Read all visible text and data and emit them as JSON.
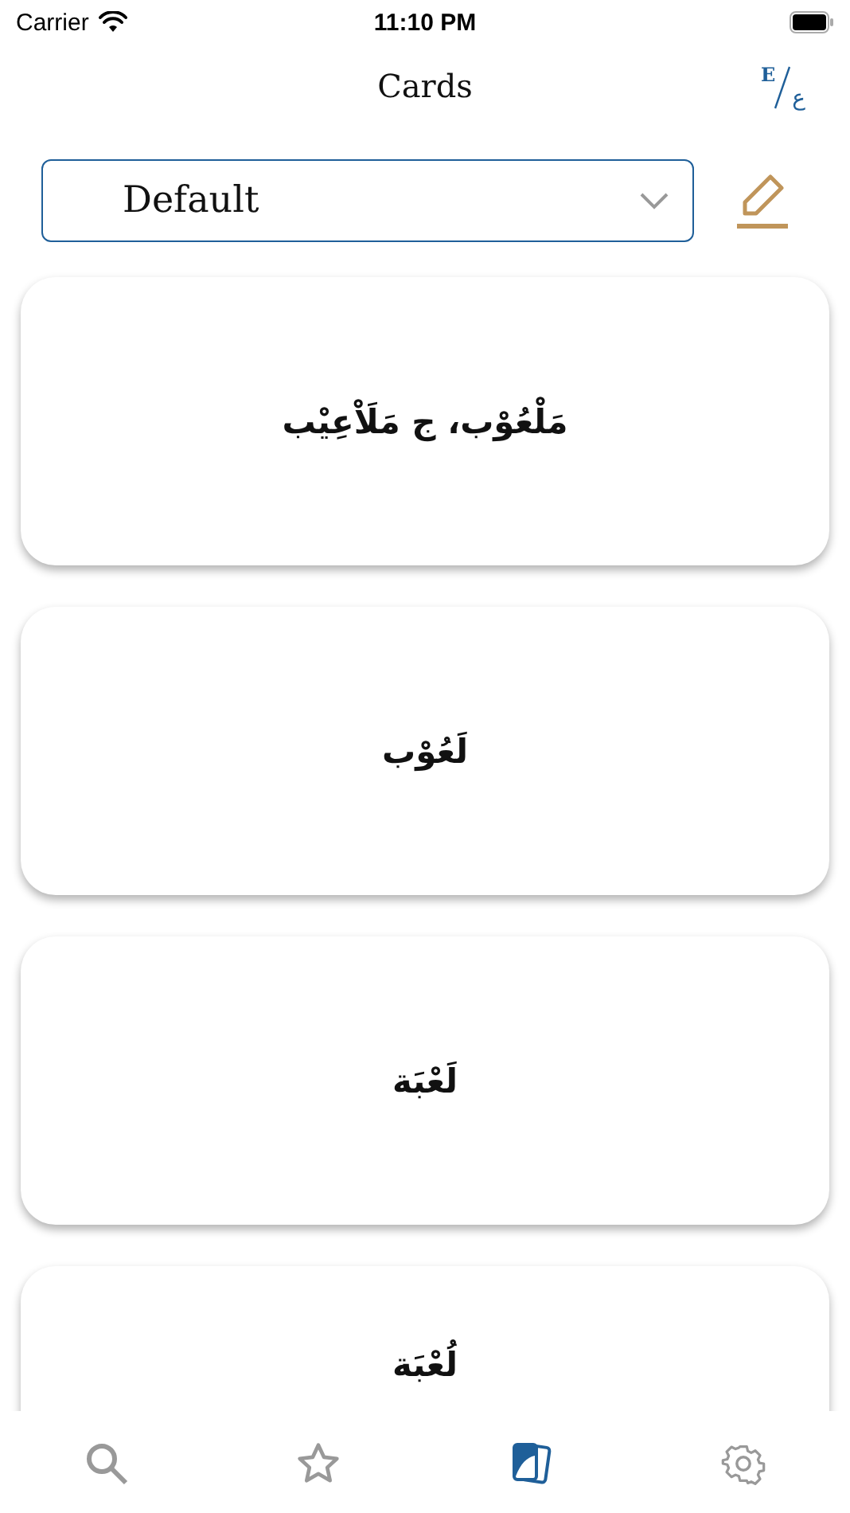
{
  "status_bar": {
    "carrier": "Carrier",
    "time": "11:10 PM"
  },
  "nav": {
    "title": "Cards",
    "language_toggle": {
      "top": "E",
      "bottom": "ع"
    }
  },
  "deck_select": {
    "value": "Default"
  },
  "cards": [
    {
      "text": "مَلْعُوْب، ج مَلَاْعِيْب"
    },
    {
      "text": "لَعُوْب"
    },
    {
      "text": "لَعْبَة"
    },
    {
      "text": "لُعْبَة"
    }
  ],
  "tabs": [
    {
      "kind": "search",
      "selected": false
    },
    {
      "kind": "favorites",
      "selected": false
    },
    {
      "kind": "cards",
      "selected": true
    },
    {
      "kind": "settings",
      "selected": false
    }
  ]
}
